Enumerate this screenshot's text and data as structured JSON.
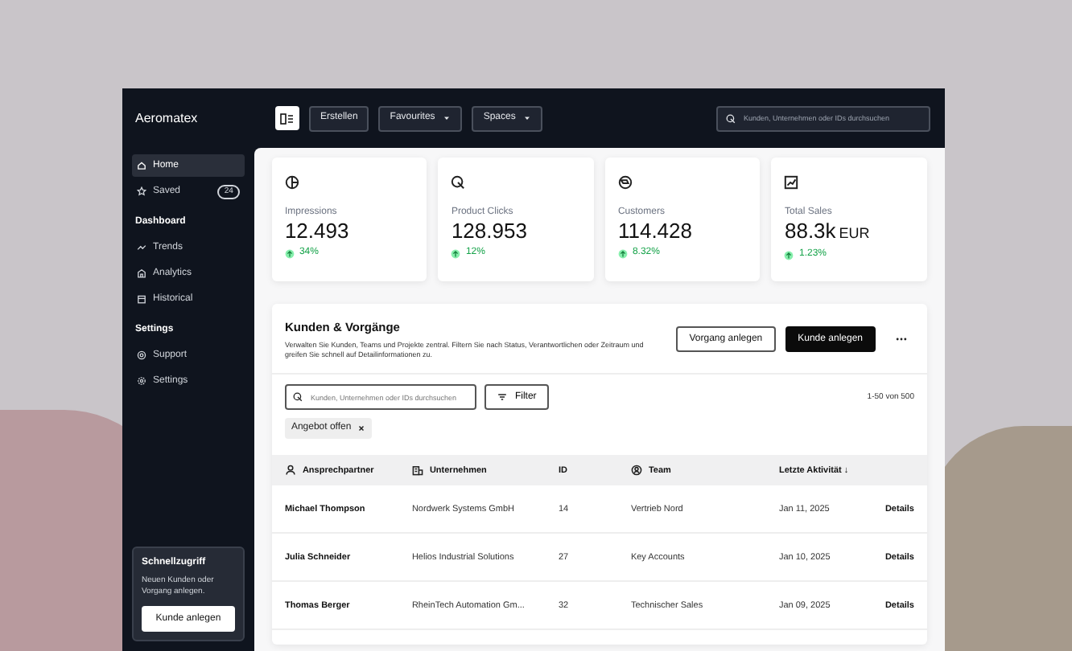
{
  "app": {
    "logo": "Aeromatex"
  },
  "toolbar": {
    "buttons": [
      {
        "label": "Erstellen",
        "kind": "plain"
      },
      {
        "label": "Favourites",
        "kind": "dropdown"
      },
      {
        "label": "Spaces",
        "kind": "dropdown"
      }
    ],
    "search": {
      "placeholder": "Kunden, Unternehmen oder IDs durchsuchen"
    }
  },
  "sidebar": {
    "sections": [
      {
        "items": [
          {
            "label": "Home",
            "kind": "home",
            "selected": true
          },
          {
            "label": "Saved",
            "kind": "star",
            "selected": false,
            "badge": "24"
          }
        ]
      },
      {
        "title": "Dashboard",
        "items": [
          {
            "label": "Trends",
            "kind": "trend",
            "selected": false
          },
          {
            "label": "Analytics",
            "kind": "chart",
            "selected": false
          },
          {
            "label": "Historical",
            "kind": "calendar",
            "selected": false
          }
        ]
      },
      {
        "title": "Settings",
        "items": [
          {
            "label": "Support",
            "kind": "help",
            "selected": false
          },
          {
            "label": "Settings",
            "kind": "gear",
            "selected": false
          }
        ]
      }
    ]
  },
  "quick_access": {
    "title": "Schnellzugriff",
    "text": "Neuen Kunden oder Vorgang anlegen.",
    "button": "Kunde anlegen"
  },
  "stats": [
    {
      "kind": "pie",
      "label": "Impressions",
      "value": "12.493",
      "change": "34%"
    },
    {
      "kind": "cursor",
      "label": "Product Clicks",
      "value": "128.953",
      "change": "12%"
    },
    {
      "kind": "globe",
      "label": "Customers",
      "value": "114.428",
      "change": "8.32%"
    },
    {
      "kind": "sales",
      "label": "Total Sales",
      "value": "88.3k",
      "unit": "EUR",
      "change": "1.23%"
    }
  ],
  "table_panel": {
    "title": "Kunden & Vorgänge",
    "description": "Verwalten Sie Kunden, Teams und Projekte zentral. Filtern Sie nach Status, Verantwortlichen oder Zeitraum und greifen Sie schnell auf Detailinformationen zu.",
    "buttons": [
      {
        "label": "Vorgang anlegen",
        "kind": "outline"
      },
      {
        "label": "Kunde anlegen",
        "kind": "solid"
      }
    ],
    "search": {
      "placeholder": "Kunden, Unternehmen oder IDs durchsuchen"
    },
    "filter_button": "Filter",
    "range": "1-50 von 500",
    "chips": [
      {
        "label": "Angebot offen"
      }
    ],
    "columns": [
      {
        "label": "Ansprechpartner",
        "kind": "person"
      },
      {
        "label": "Unternehmen",
        "kind": "building"
      },
      {
        "label": "ID",
        "kind": "none"
      },
      {
        "label": "Team",
        "kind": "team"
      },
      {
        "label": "Letzte Aktivität ↓",
        "kind": "none"
      }
    ],
    "rows": [
      {
        "contact": "Michael Thompson",
        "company": "Nordwerk Systems GmbH",
        "id": "14",
        "team": "Vertrieb Nord",
        "date": "Jan 11, 2025",
        "action": "Details"
      },
      {
        "contact": "Julia Schneider",
        "company": "Helios Industrial Solutions",
        "id": "27",
        "team": "Key Accounts",
        "date": "Jan 10, 2025",
        "action": "Details"
      },
      {
        "contact": "Thomas Berger",
        "company": "RheinTech Automation Gm...",
        "id": "32",
        "team": "Technischer Sales",
        "date": "Jan 09, 2025",
        "action": "Details"
      }
    ]
  }
}
